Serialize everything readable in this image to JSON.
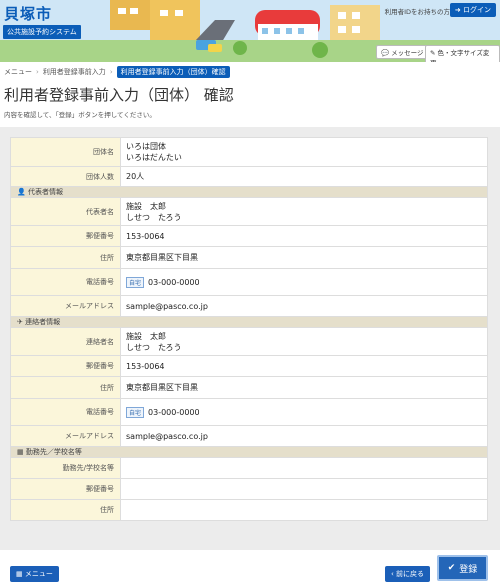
{
  "header": {
    "city": "貝塚市",
    "system_name": "公共施設予約システム",
    "login_note": "利用者IDをお持ちの方",
    "login_label": "ログイン",
    "message_label": "メッセージ",
    "color_size_label": "色・文字サイズ変更"
  },
  "breadcrumb": [
    "メニュー",
    "利用者登録事前入力",
    "利用者登録事前入力（団体）確認"
  ],
  "page": {
    "title": "利用者登録事前入力（団体） 確認",
    "subtitle": "内容を確認して、「登録」ボタンを押してください。"
  },
  "form": {
    "group": {
      "name_label": "団体名",
      "name_value": "いろは団体",
      "name_kana": "いろはだんたい",
      "count_label": "団体人数",
      "count_value": "20人"
    },
    "representative": {
      "section": "代表者情報",
      "name_label": "代表者名",
      "name_value": "施設　太郎",
      "name_kana": "しせつ　たろう",
      "zip_label": "郵便番号",
      "zip_value": "153-0064",
      "address_label": "住所",
      "address_value": "東京都目黒区下目黒",
      "phone_label": "電話番号",
      "phone_tag": "自宅",
      "phone_value": "03-000-0000",
      "email_label": "メールアドレス",
      "email_value": "sample@pasco.co.jp"
    },
    "contact": {
      "section": "連絡者情報",
      "name_label": "連絡者名",
      "name_value": "施設　太郎",
      "name_kana": "しせつ　たろう",
      "zip_label": "郵便番号",
      "zip_value": "153-0064",
      "address_label": "住所",
      "address_value": "東京都目黒区下目黒",
      "phone_label": "電話番号",
      "phone_tag": "自宅",
      "phone_value": "03-000-0000",
      "email_label": "メールアドレス",
      "email_value": "sample@pasco.co.jp"
    },
    "workplace": {
      "section": "勤務先／学校名等",
      "name_label": "勤務先/学校名等",
      "name_value": "",
      "zip_label": "郵便番号",
      "zip_value": "",
      "address_label": "住所",
      "address_value": ""
    }
  },
  "footer": {
    "menu_label": "メニュー",
    "back_label": "前に戻る",
    "register_label": "登録"
  },
  "colors": {
    "primary": "#0b5db8",
    "label_bg": "#fbf6da",
    "section_bg": "#e5dfcb"
  }
}
